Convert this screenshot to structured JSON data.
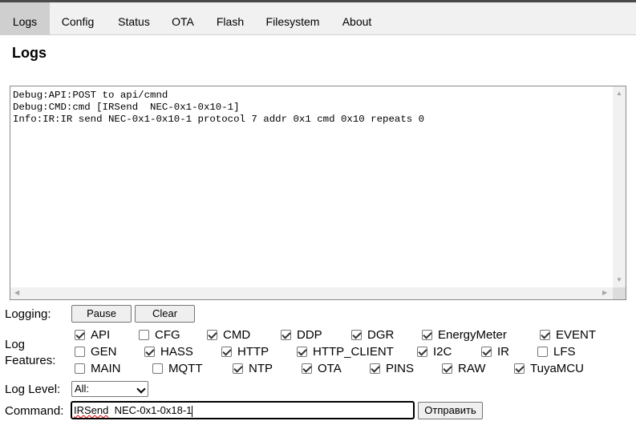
{
  "tabs": [
    {
      "label": "Logs",
      "active": true
    },
    {
      "label": "Config"
    },
    {
      "label": "Status"
    },
    {
      "label": "OTA"
    },
    {
      "label": "Flash"
    },
    {
      "label": "Filesystem"
    },
    {
      "label": "About"
    }
  ],
  "page_title": "Logs",
  "log_lines": [
    "Debug:API:POST to api/cmnd",
    "Debug:CMD:cmd [IRSend  NEC-0x1-0x10-1]",
    "Info:IR:IR send NEC-0x1-0x10-1 protocol 7 addr 0x1 cmd 0x10 repeats 0"
  ],
  "logging": {
    "label": "Logging:",
    "pause_label": "Pause",
    "clear_label": "Clear"
  },
  "features": {
    "label_line1": "Log",
    "label_line2": "Features:",
    "items": [
      {
        "name": "API",
        "checked": true
      },
      {
        "name": "CFG",
        "checked": false
      },
      {
        "name": "CMD",
        "checked": true
      },
      {
        "name": "DDP",
        "checked": true
      },
      {
        "name": "DGR",
        "checked": true
      },
      {
        "name": "EnergyMeter",
        "checked": true
      },
      {
        "name": "EVENT",
        "checked": true
      },
      {
        "name": "GEN",
        "checked": false
      },
      {
        "name": "HASS",
        "checked": true
      },
      {
        "name": "HTTP",
        "checked": true
      },
      {
        "name": "HTTP_CLIENT",
        "checked": true
      },
      {
        "name": "I2C",
        "checked": true
      },
      {
        "name": "IR",
        "checked": true
      },
      {
        "name": "LFS",
        "checked": false
      },
      {
        "name": "MAIN",
        "checked": false
      },
      {
        "name": "MQTT",
        "checked": false
      },
      {
        "name": "NTP",
        "checked": true
      },
      {
        "name": "OTA",
        "checked": true
      },
      {
        "name": "PINS",
        "checked": true
      },
      {
        "name": "RAW",
        "checked": true
      },
      {
        "name": "TuyaMCU",
        "checked": true
      }
    ]
  },
  "log_level": {
    "label": "Log Level:",
    "value": "All:"
  },
  "command": {
    "label": "Command:",
    "value_word": "IRSend",
    "value_rest": "  NEC-0x1-0x18-1",
    "send_label": "Отправить"
  },
  "icons": {
    "scroll_up": "triangle-up",
    "scroll_down": "triangle-down",
    "scroll_left": "triangle-left",
    "scroll_right": "triangle-right",
    "select": "chevron-down"
  }
}
